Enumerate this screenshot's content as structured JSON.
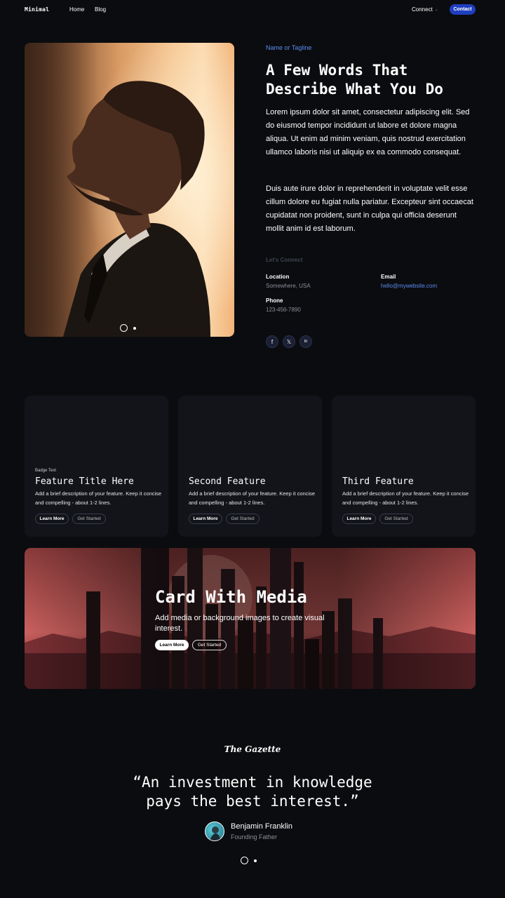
{
  "nav": {
    "logo": "Minimal",
    "links": [
      "Home",
      "Blog"
    ],
    "connect": "Connect",
    "contact": "Contact"
  },
  "hero": {
    "tagline": "Name or Tagline",
    "title": "A Few Words That Describe What You Do",
    "p1": "Lorem ipsum dolor sit amet, consectetur adipiscing elit. Sed do eiusmod tempor incididunt ut labore et dolore magna aliqua. Ut enim ad minim veniam, quis nostrud exercitation ullamco laboris nisi ut aliquip ex ea commodo consequat.",
    "p2": "Duis aute irure dolor in reprehenderit in voluptate velit esse cillum dolore eu fugiat nulla pariatur. Excepteur sint occaecat cupidatat non proident, sunt in culpa qui officia deserunt mollit anim id est laborum."
  },
  "contact_info": {
    "heading": "Let's Connect",
    "location_label": "Location",
    "location_value": "Somewhere, USA",
    "email_label": "Email",
    "email_value": "hello@mywebsite.com",
    "phone_label": "Phone",
    "phone_value": "123-456-7890"
  },
  "social": {
    "facebook": "f",
    "x": "𝕏",
    "linkedin": "in"
  },
  "features": [
    {
      "badge": "Badge Text",
      "title": "Feature Title Here",
      "desc": "Add a brief description of your feature. Keep it concise and compelling - about 1-2 lines.",
      "learn": "Learn More",
      "start": "Get Started"
    },
    {
      "badge": "",
      "title": "Second Feature",
      "desc": "Add a brief description of your feature. Keep it concise and compelling - about 1-2 lines.",
      "learn": "Learn More",
      "start": "Get Started"
    },
    {
      "badge": "",
      "title": "Third Feature",
      "desc": "Add a brief description of your feature. Keep it concise and compelling - about 1-2 lines.",
      "learn": "Learn More",
      "start": "Get Started"
    }
  ],
  "media_card": {
    "title": "Card With Media",
    "desc": "Add media or background images to create visual interest.",
    "learn": "Learn More",
    "start": "Get Started"
  },
  "testimonial": {
    "publication": "The Gazette",
    "quote": "“An investment in knowledge pays the best interest.”",
    "author": "Benjamin Franklin",
    "role": "Founding Father"
  },
  "colors": {
    "background": "#0b0c0f",
    "accent": "#1f3fbf",
    "link": "#5b8cf0",
    "card": "#12141a"
  },
  "icons": [
    "chevron-down-icon",
    "facebook-icon",
    "x-icon",
    "linkedin-icon"
  ]
}
